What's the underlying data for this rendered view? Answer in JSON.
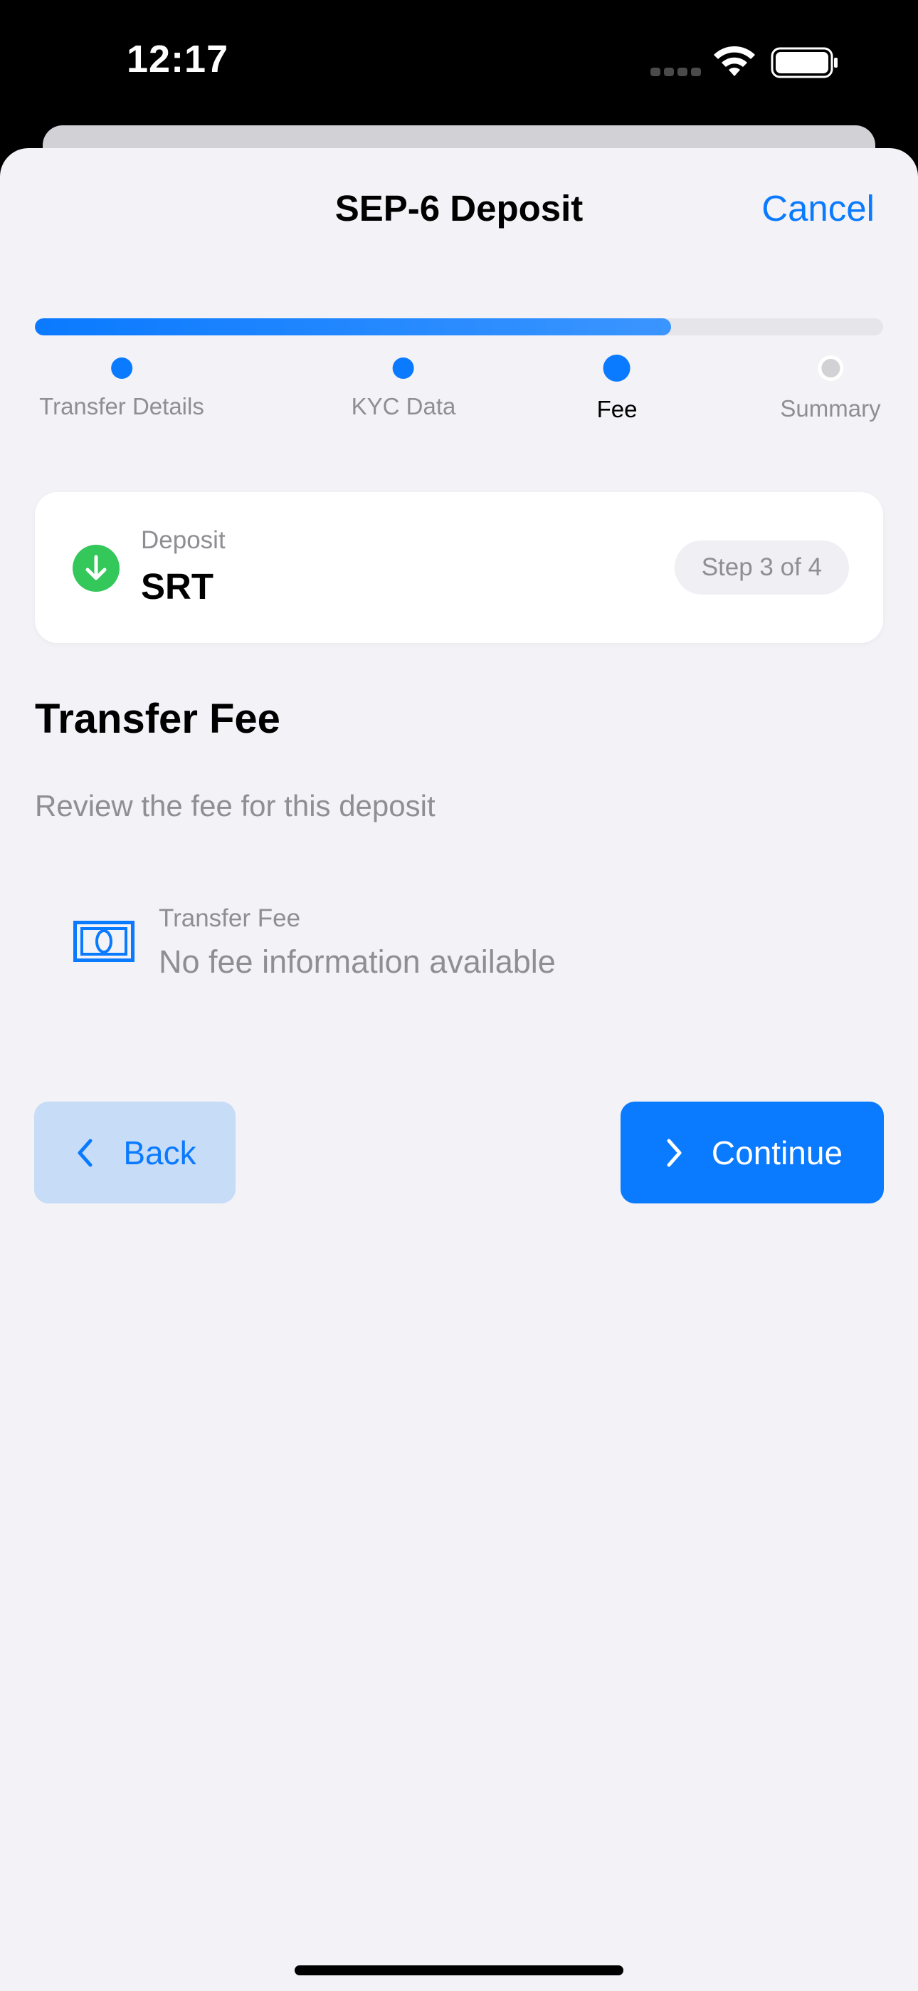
{
  "status_bar": {
    "time": "12:17",
    "icons": [
      "signal-dots-icon",
      "wifi-icon",
      "battery-icon"
    ]
  },
  "nav": {
    "title": "SEP-6 Deposit",
    "cancel_label": "Cancel"
  },
  "progress": {
    "fraction": 0.75,
    "steps": [
      {
        "label": "Transfer Details",
        "state": "done"
      },
      {
        "label": "KYC Data",
        "state": "done"
      },
      {
        "label": "Fee",
        "state": "current"
      },
      {
        "label": "Summary",
        "state": "pending"
      }
    ]
  },
  "deposit_card": {
    "type_label": "Deposit",
    "asset": "SRT",
    "step_badge": "Step 3 of 4",
    "icon": "arrow-down-circle-icon"
  },
  "section": {
    "title": "Transfer Fee",
    "subtitle": "Review the fee for this deposit"
  },
  "fee": {
    "icon": "banknote-icon",
    "label": "Transfer Fee",
    "value": "No fee information available"
  },
  "buttons": {
    "back_label": "Back",
    "continue_label": "Continue"
  },
  "colors": {
    "accent": "#0A7AFF",
    "success": "#34C759",
    "background": "#F2F2F7",
    "secondary_text": "#8E8E93"
  }
}
